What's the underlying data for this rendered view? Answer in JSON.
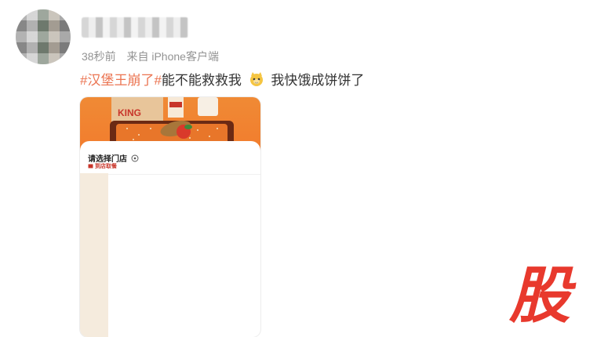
{
  "post": {
    "time": "38秒前",
    "source": "来自 iPhone客户端",
    "hashtag": "#汉堡王崩了#",
    "text_before_emoji": "能不能救救我",
    "emoji": "cat-emoji",
    "text_after_emoji": "我快饿成饼饼了"
  },
  "card": {
    "title": "请选择门店",
    "subtitle": "到店取餐",
    "bag_brand": "KING"
  },
  "watermark": {
    "text": "股"
  },
  "colors": {
    "hashtag": "#eb7350",
    "hero": "#f27a2c",
    "sidebar": "#f5ebdd",
    "watermark": "#e8392d"
  }
}
